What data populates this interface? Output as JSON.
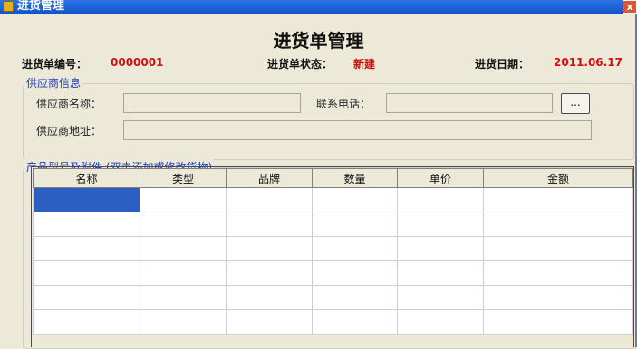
{
  "window": {
    "title": "进货管理",
    "close_label": "x"
  },
  "header": {
    "title": "进货单管理"
  },
  "order": {
    "number_label": "进货单编号：",
    "number_value": "0000001",
    "status_label": "进货单状态：",
    "status_value": "新建",
    "date_label": "进货日期：",
    "date_value": "2011.06.17"
  },
  "supplier": {
    "group_title": "供应商信息",
    "name_label": "供应商名称：",
    "name_value": "",
    "phone_label": "联系电话：",
    "phone_value": "",
    "browse_label": "...",
    "address_label": "供应商地址：",
    "address_value": ""
  },
  "products": {
    "group_title": "产品型号及附件 (双击添加或修改货物)",
    "columns": [
      "名称",
      "类型",
      "品牌",
      "数量",
      "单价",
      "金额"
    ],
    "rows": [
      [
        "",
        "",
        "",
        "",
        "",
        ""
      ],
      [
        "",
        "",
        "",
        "",
        "",
        ""
      ],
      [
        "",
        "",
        "",
        "",
        "",
        ""
      ],
      [
        "",
        "",
        "",
        "",
        "",
        ""
      ],
      [
        "",
        "",
        "",
        "",
        "",
        ""
      ],
      [
        "",
        "",
        "",
        "",
        "",
        ""
      ]
    ]
  }
}
